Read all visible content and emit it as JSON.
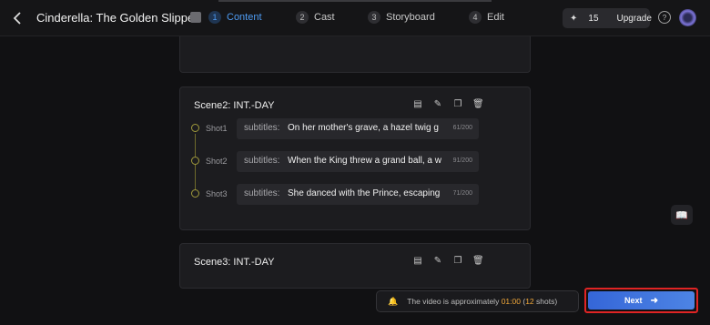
{
  "header": {
    "title": "Cinderella: The Golden Slipper",
    "steps": [
      {
        "num": "1",
        "label": "Content"
      },
      {
        "num": "2",
        "label": "Cast"
      },
      {
        "num": "3",
        "label": "Storyboard"
      },
      {
        "num": "4",
        "label": "Edit"
      }
    ],
    "active_step": "Content",
    "credits": "15",
    "upgrade_label": "Upgrade",
    "help_label": "?"
  },
  "scenes": [
    {
      "title": "Scene2: INT.-DAY",
      "shots": [
        {
          "label": "Shot1",
          "key": "subtitles:",
          "value": "On her mother's grave, a hazel twig g",
          "count": "61/200"
        },
        {
          "label": "Shot2",
          "key": "subtitles:",
          "value": "When the King threw a grand ball, a w",
          "count": "91/200"
        },
        {
          "label": "Shot3",
          "key": "subtitles:",
          "value": "She danced with the Prince, escaping",
          "count": "71/200"
        }
      ]
    },
    {
      "title": "Scene3: INT.-DAY",
      "shots": []
    }
  ],
  "footer": {
    "notice_prefix": "The video is approximately",
    "duration": "01:00",
    "open_paren": "(",
    "shots_count": "12",
    "shots_suffix": "shots)",
    "next_label": "Next"
  },
  "colors": {
    "accent": "#4e9bf2",
    "highlight": "#f0a73a",
    "next_button": "#3566d8",
    "highlight_border": "#e02424"
  }
}
